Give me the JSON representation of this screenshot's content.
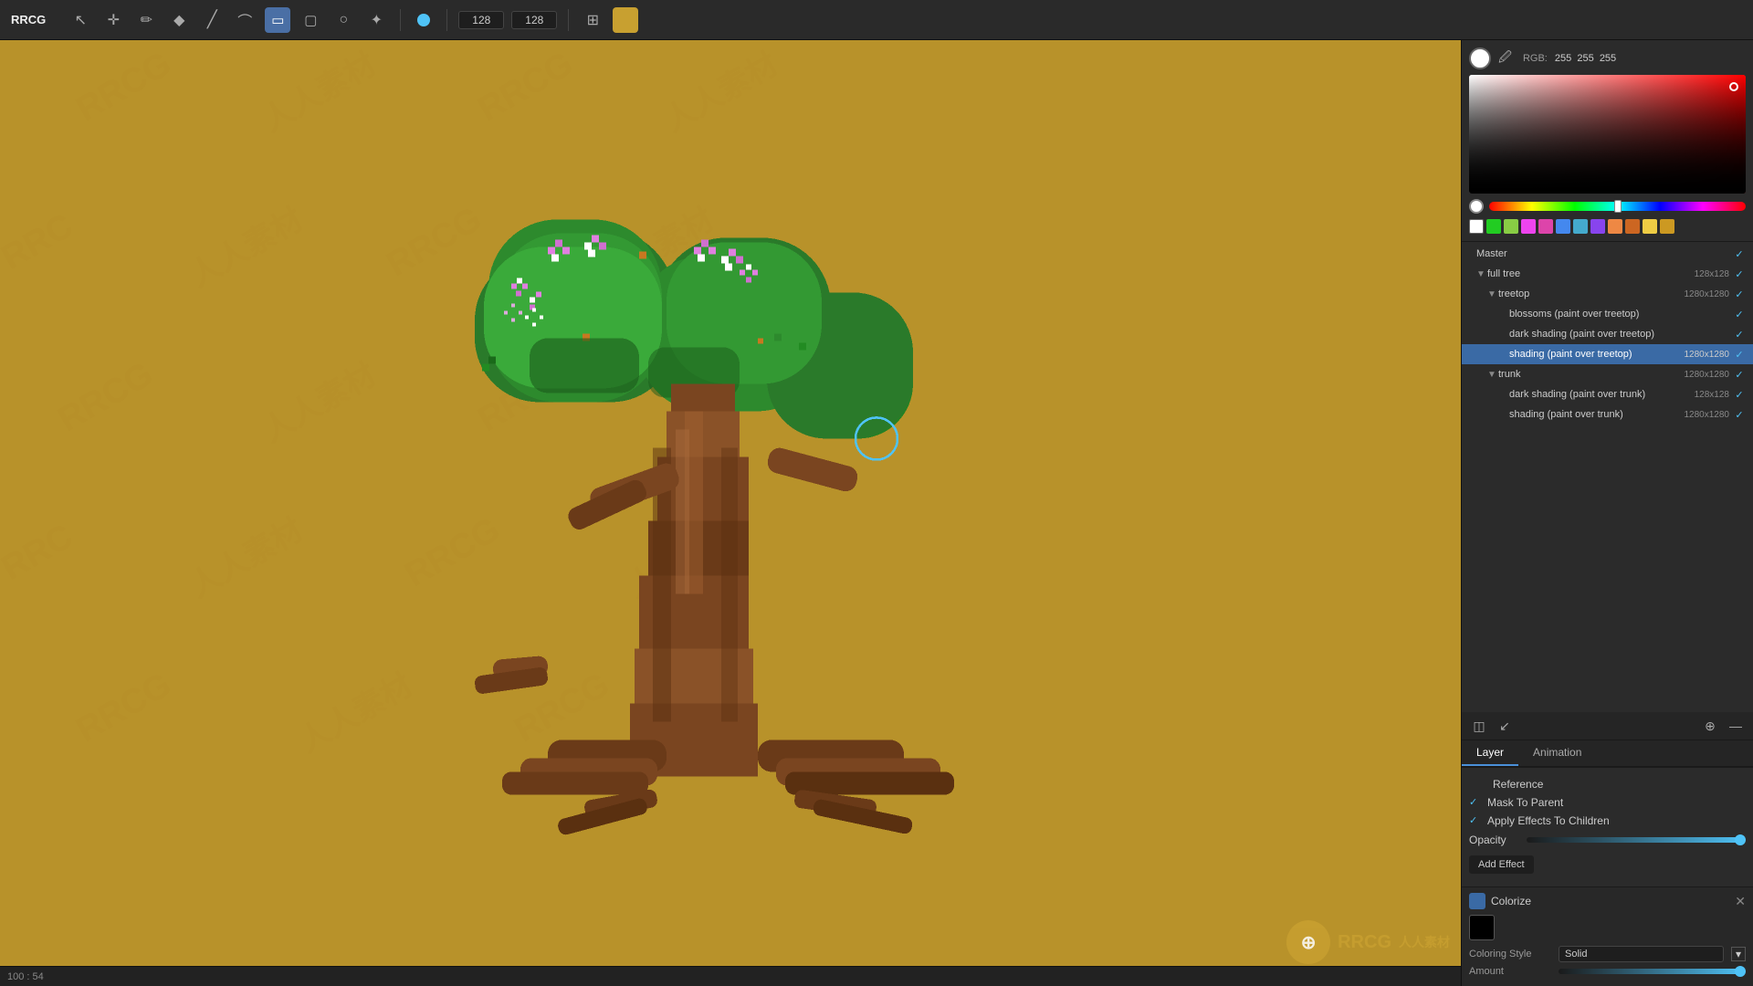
{
  "app": {
    "title": "RRCG"
  },
  "toolbar": {
    "tools": [
      {
        "name": "select",
        "icon": "↖",
        "active": false
      },
      {
        "name": "move",
        "icon": "+",
        "active": false
      },
      {
        "name": "pencil",
        "icon": "✏",
        "active": false
      },
      {
        "name": "fill",
        "icon": "◆",
        "active": false
      },
      {
        "name": "line",
        "icon": "/",
        "active": false
      },
      {
        "name": "curve",
        "icon": "~",
        "active": false
      },
      {
        "name": "rect",
        "icon": "▭",
        "active": true
      },
      {
        "name": "shape",
        "icon": "▢",
        "active": false
      },
      {
        "name": "circle",
        "icon": "○",
        "active": false
      },
      {
        "name": "pattern",
        "icon": "✦",
        "active": false
      }
    ],
    "brush_color": "#4fc3f7",
    "size_w": "128",
    "size_h": "128",
    "grid_icon": "⊞",
    "color_swatch": "#c8a030"
  },
  "color_picker": {
    "rgb_label": "RGB:",
    "r": "255",
    "g": "255",
    "b": "255",
    "swatches": [
      "#ff0000",
      "#00ff00",
      "#0000ff",
      "#ffff00",
      "#ff00ff",
      "#00ffff",
      "#c8a030",
      "#ffffff"
    ]
  },
  "layers": {
    "items": [
      {
        "id": "master",
        "name": "Master",
        "indent": 0,
        "size": "",
        "check": true,
        "arrow": ""
      },
      {
        "id": "full-tree",
        "name": "full tree",
        "indent": 1,
        "size": "128x128",
        "check": true,
        "arrow": "▼"
      },
      {
        "id": "treetop",
        "name": "treetop",
        "indent": 2,
        "size": "1280x1280",
        "check": true,
        "arrow": "▼"
      },
      {
        "id": "blossoms",
        "name": "blossoms (paint over treetop)",
        "indent": 3,
        "size": "",
        "check": true,
        "arrow": ""
      },
      {
        "id": "dark-shading-treetop",
        "name": "dark shading (paint over treetop)",
        "indent": 3,
        "size": "",
        "check": true,
        "arrow": ""
      },
      {
        "id": "shading-treetop",
        "name": "shading (paint over treetop)",
        "indent": 3,
        "size": "1280x1280",
        "check": true,
        "arrow": "",
        "selected": true
      },
      {
        "id": "trunk",
        "name": "trunk",
        "indent": 2,
        "size": "1280x1280",
        "check": true,
        "arrow": "▼"
      },
      {
        "id": "dark-shading-trunk",
        "name": "dark shading (paint over trunk)",
        "indent": 3,
        "size": "128x128",
        "check": true,
        "arrow": ""
      },
      {
        "id": "shading-trunk",
        "name": "shading (paint over trunk)",
        "indent": 3,
        "size": "1280x1280",
        "check": true,
        "arrow": ""
      }
    ],
    "toolbar_buttons": [
      "◫",
      "↙",
      "⊕",
      "—"
    ]
  },
  "tabs": {
    "layer": "Layer",
    "animation": "Animation"
  },
  "layer_props": {
    "reference_label": "Reference",
    "mask_to_parent": "Mask To Parent",
    "mask_check": "✓",
    "apply_effects": "Apply Effects To Children",
    "apply_check": "✓",
    "opacity_label": "Opacity",
    "add_effect_label": "Add Effect"
  },
  "effect": {
    "name": "Colorize",
    "swatch_color": "#3a6aa5",
    "coloring_style_label": "Coloring Style",
    "coloring_style_value": "Solid",
    "amount_label": "Amount"
  },
  "status": {
    "zoom": "100",
    "pos": "54"
  }
}
